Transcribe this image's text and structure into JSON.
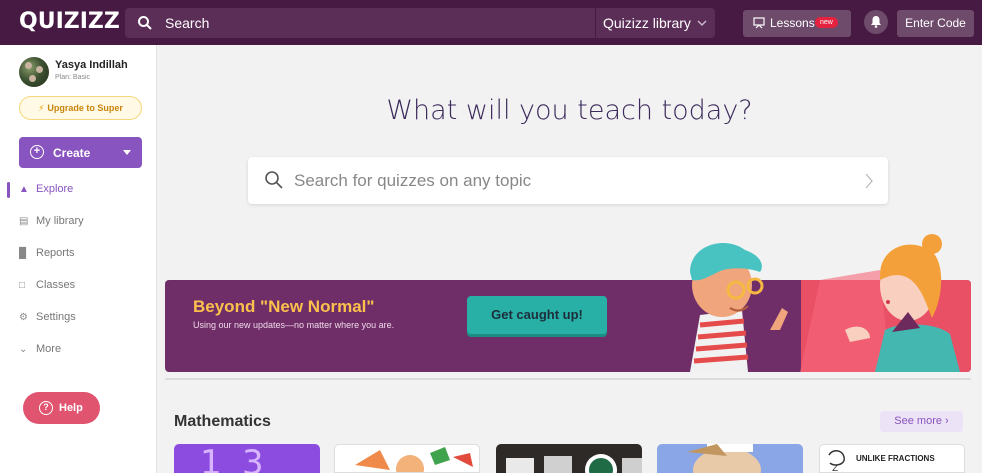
{
  "topbar": {
    "logo": "QUIZIZZ",
    "search_label": "Search",
    "library_label": "Quizizz library",
    "lessons_label": "Lessons",
    "lessons_badge": "new",
    "enter_code_label": "Enter Code",
    "icons": [
      "search-icon",
      "chevron-down-icon",
      "presentation-icon",
      "bell-icon"
    ]
  },
  "user": {
    "name": "Yasya Indillah",
    "plan": "Plan: Basic",
    "upgrade_label": "Upgrade to Super"
  },
  "sidebar": {
    "create_label": "Create",
    "items": [
      {
        "label": "Explore",
        "icon": "explore-icon",
        "active": true
      },
      {
        "label": "My library",
        "icon": "library-icon",
        "active": false
      },
      {
        "label": "Reports",
        "icon": "reports-icon",
        "active": false
      },
      {
        "label": "Classes",
        "icon": "classes-icon",
        "active": false
      },
      {
        "label": "Settings",
        "icon": "settings-icon",
        "active": false
      },
      {
        "label": "More",
        "icon": "chevron-down-icon",
        "active": false
      }
    ],
    "help_label": "Help"
  },
  "main": {
    "headline": "What will you teach today?",
    "search_placeholder": "Search for quizzes on any topic",
    "banner": {
      "title": "Beyond \"New Normal\"",
      "subtitle": "Using our new updates—no matter where you are.",
      "button_label": "Get caught up!"
    },
    "section_title": "Mathematics",
    "see_more_label": "See more",
    "card5_text": "UNLIKE FRACTIONS"
  },
  "colors": {
    "topbar": "#461a42",
    "accent": "#8854c0",
    "banner": "#6f2e67",
    "banner_title": "#fcc14d",
    "banner_button": "#28b0a6",
    "help": "#e05470"
  }
}
